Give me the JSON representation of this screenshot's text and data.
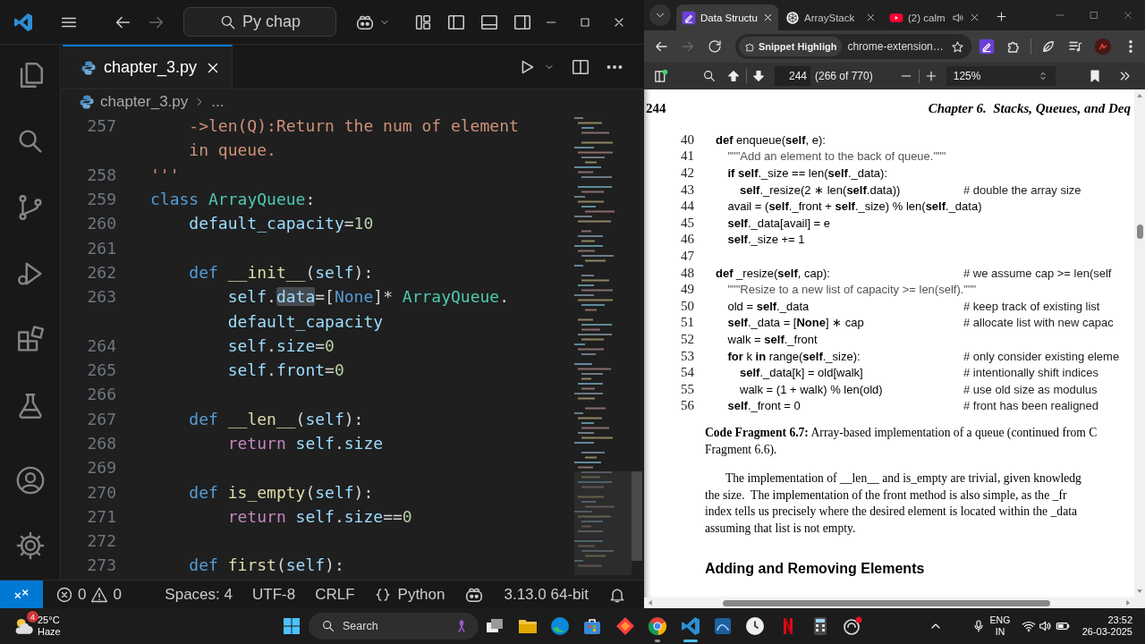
{
  "vscode": {
    "title_bar": {
      "search": "Py chap",
      "back_disabled": false,
      "forward_disabled": true
    },
    "tabs": [
      {
        "label": "chapter_3.py",
        "selected": true
      }
    ],
    "breadcrumb": [
      {
        "kind": "file",
        "label": "chapter_3.py"
      },
      {
        "kind": "symbol",
        "label": "..."
      }
    ],
    "code_lines": [
      {
        "number": "257",
        "tokens": [
          {
            "kind": "string",
            "text": "    ->len(Q):Return the num of element"
          }
        ]
      },
      {
        "tokens": [
          {
            "kind": "string",
            "text": "    in queue."
          }
        ]
      },
      {
        "number": "258",
        "tokens": [
          {
            "kind": "string",
            "text": "'''"
          }
        ]
      },
      {
        "number": "259",
        "tokens": [
          {
            "kind": "keyword",
            "text": "class "
          },
          {
            "kind": "class",
            "text": "ArrayQueue"
          },
          {
            "kind": "plain",
            "text": ":"
          }
        ]
      },
      {
        "number": "260",
        "tokens": [
          {
            "kind": "variable",
            "text": "    default_capacity"
          },
          {
            "kind": "plain",
            "text": "="
          },
          {
            "kind": "number",
            "text": "10"
          }
        ]
      },
      {
        "number": "261"
      },
      {
        "number": "262",
        "tokens": [
          {
            "kind": "keyword",
            "text": "    def "
          },
          {
            "kind": "function",
            "text": "__init__"
          },
          {
            "kind": "plain",
            "text": "("
          },
          {
            "kind": "variable",
            "text": "self"
          },
          {
            "kind": "plain",
            "text": "):"
          }
        ]
      },
      {
        "number": "263",
        "tokens": [
          {
            "kind": "variable",
            "text": "        self"
          },
          {
            "kind": "plain",
            "text": "."
          },
          {
            "kind": "variable",
            "text": "data",
            "highlighted": true
          },
          {
            "kind": "plain",
            "text": "=["
          },
          {
            "kind": "keyword",
            "text": "None"
          },
          {
            "kind": "plain",
            "text": "]* "
          },
          {
            "kind": "class",
            "text": "ArrayQueue"
          },
          {
            "kind": "plain",
            "text": "."
          }
        ]
      },
      {
        "tokens": [
          {
            "kind": "variable",
            "text": "        default_capacity"
          }
        ]
      },
      {
        "number": "264",
        "tokens": [
          {
            "kind": "variable",
            "text": "        self"
          },
          {
            "kind": "plain",
            "text": "."
          },
          {
            "kind": "variable",
            "text": "size"
          },
          {
            "kind": "plain",
            "text": "="
          },
          {
            "kind": "number",
            "text": "0"
          }
        ]
      },
      {
        "number": "265",
        "tokens": [
          {
            "kind": "variable",
            "text": "        self"
          },
          {
            "kind": "plain",
            "text": "."
          },
          {
            "kind": "variable",
            "text": "front"
          },
          {
            "kind": "plain",
            "text": "="
          },
          {
            "kind": "number",
            "text": "0"
          }
        ]
      },
      {
        "number": "266"
      },
      {
        "number": "267",
        "tokens": [
          {
            "kind": "keyword",
            "text": "    def "
          },
          {
            "kind": "function",
            "text": "__len__"
          },
          {
            "kind": "plain",
            "text": "("
          },
          {
            "kind": "variable",
            "text": "self"
          },
          {
            "kind": "plain",
            "text": "):"
          }
        ]
      },
      {
        "number": "268",
        "tokens": [
          {
            "kind": "control",
            "text": "        return "
          },
          {
            "kind": "variable",
            "text": "self"
          },
          {
            "kind": "plain",
            "text": "."
          },
          {
            "kind": "variable",
            "text": "size"
          }
        ]
      },
      {
        "number": "269"
      },
      {
        "number": "270",
        "tokens": [
          {
            "kind": "keyword",
            "text": "    def "
          },
          {
            "kind": "function",
            "text": "is_empty"
          },
          {
            "kind": "plain",
            "text": "("
          },
          {
            "kind": "variable",
            "text": "self"
          },
          {
            "kind": "plain",
            "text": "):"
          }
        ]
      },
      {
        "number": "271",
        "tokens": [
          {
            "kind": "control",
            "text": "        return "
          },
          {
            "kind": "variable",
            "text": "self"
          },
          {
            "kind": "plain",
            "text": "."
          },
          {
            "kind": "variable",
            "text": "size"
          },
          {
            "kind": "plain",
            "text": "=="
          },
          {
            "kind": "number",
            "text": "0"
          }
        ]
      },
      {
        "number": "272"
      },
      {
        "number": "273",
        "tokens": [
          {
            "kind": "keyword",
            "text": "    def "
          },
          {
            "kind": "function",
            "text": "first"
          },
          {
            "kind": "plain",
            "text": "("
          },
          {
            "kind": "variable",
            "text": "self"
          },
          {
            "kind": "plain",
            "text": "):"
          }
        ]
      }
    ],
    "status_bar": {
      "errors": "0",
      "warnings": "0",
      "items": [
        {
          "kind": "text",
          "label": "Spaces: 4"
        },
        {
          "kind": "text",
          "label": "UTF-8"
        },
        {
          "kind": "text",
          "label": "CRLF"
        },
        {
          "kind": "language",
          "label": "Python"
        },
        {
          "kind": "copilot"
        },
        {
          "kind": "text",
          "label": "3.13.0 64-bit"
        },
        {
          "kind": "bell"
        }
      ]
    }
  },
  "browser": {
    "tabs": [
      {
        "kind": "pen",
        "title": "Data Structu",
        "audio": false,
        "selected": true
      },
      {
        "kind": "knot",
        "title": "ArrayStack",
        "audio": false,
        "selected": false
      },
      {
        "kind": "video",
        "title": "(2) calm",
        "audio": true,
        "selected": false
      }
    ],
    "back_disabled": false,
    "forward_disabled": true,
    "omnibox": {
      "chip": "Snippet Highligh",
      "url": "chrome-extension…"
    },
    "pdf_toolbar": {
      "page": "244",
      "page_count": "(266 of 770)",
      "zoom": "125%"
    },
    "page": {
      "page_number": "244",
      "running_head": "Chapter 6.  Stacks, Queues, and Deq",
      "listing": [
        {
          "number": "40",
          "kind": "code",
          "code": "**def** enqueue(**self**, e):",
          "children": [
            {
              "number": "41",
              "kind": "docstring",
              "code": "\"\"\"Add an element to the back of queue.\"\"\""
            },
            {
              "number": "42",
              "kind": "code",
              "code": "**if** **self**._size == len(**self**._data):",
              "children": [
                {
                  "number": "43",
                  "kind": "code",
                  "code": "**self**._resize(2 ∗ len(**self**.data))",
                  "comment": "# double the array size"
                }
              ]
            },
            {
              "number": "44",
              "kind": "code",
              "code": "avail = (**self**._front + **self**._size) % len(**self**._data)"
            },
            {
              "number": "45",
              "kind": "code",
              "code": "**self**._data[avail] = e"
            },
            {
              "number": "46",
              "kind": "code",
              "code": "**self**._size += 1"
            }
          ]
        },
        {
          "number": "47",
          "kind": "code"
        },
        {
          "number": "48",
          "kind": "code",
          "code": "**def** _resize(**self**, cap):",
          "comment": "# we assume cap >= len(self",
          "children": [
            {
              "number": "49",
              "kind": "docstring",
              "code": "\"\"\"Resize to a new list of capacity >= len(self).\"\"\""
            },
            {
              "number": "50",
              "kind": "code",
              "code": "old = **self**._data",
              "comment": "# keep track of existing list"
            },
            {
              "number": "51",
              "kind": "code",
              "code": "**self**._data = [**None**] ∗ cap",
              "comment": "# allocate list with new capac"
            },
            {
              "number": "52",
              "kind": "code",
              "code": "walk = **self**._front"
            },
            {
              "number": "53",
              "kind": "code",
              "code": "**for** k **in** range(**self**._size):",
              "comment": "# only consider existing eleme",
              "children": [
                {
                  "number": "54",
                  "kind": "code",
                  "code": "**self**._data[k] = old[walk]",
                  "comment": "# intentionally shift indices"
                },
                {
                  "number": "55",
                  "kind": "code",
                  "code": "walk = (1 + walk) % len(old)",
                  "comment": "# use old size as modulus"
                }
              ]
            },
            {
              "number": "56",
              "kind": "code",
              "code": "**self**._front = 0",
              "comment": "# front has been realigned"
            }
          ]
        }
      ],
      "caption_lines": [
        "**Code Fragment 6.7:** Array-based implementation of a queue (continued from C",
        "Fragment 6.6)."
      ],
      "paragraph_lines": [
        "The implementation of __len__ and is_empty are trivial, given knowledg",
        "the size.  The implementation of the front method is also simple, as the _fr",
        "index tells us precisely where the desired element is located within the _data",
        "assuming that list is not empty."
      ],
      "heading": "Adding and Removing Elements"
    }
  },
  "taskbar": {
    "weather": {
      "badge": "4",
      "temperature": "25°C",
      "condition": "Haze"
    },
    "search": "Search",
    "apps": [
      {
        "kind": "task-view",
        "running": false,
        "active": false
      },
      {
        "kind": "folder",
        "running": false,
        "active": false
      },
      {
        "kind": "wave",
        "running": false,
        "active": false
      },
      {
        "kind": "bag",
        "running": false,
        "active": false
      },
      {
        "kind": "diamond",
        "running": false,
        "active": false
      },
      {
        "kind": "browser",
        "running": true,
        "active": false
      },
      {
        "kind": "editor",
        "running": true,
        "active": true
      },
      {
        "kind": "chart",
        "running": false,
        "active": false
      },
      {
        "kind": "clock",
        "running": false,
        "active": false
      },
      {
        "kind": "stripes",
        "running": false,
        "active": false
      },
      {
        "kind": "calculator",
        "running": false,
        "active": false
      },
      {
        "kind": "ring",
        "running": false,
        "active": false
      }
    ],
    "language": "ENG",
    "region": "IN",
    "time": "23:52",
    "date": "26-03-2025"
  }
}
